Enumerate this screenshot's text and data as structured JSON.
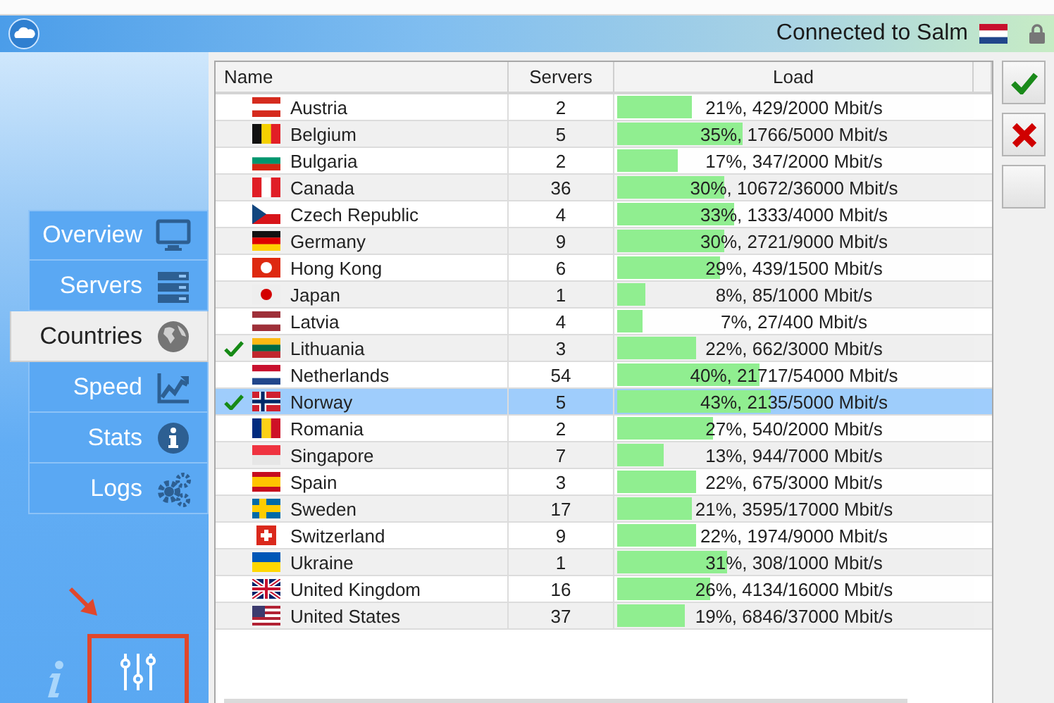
{
  "title_bar": {
    "status": "Connected to Salm"
  },
  "sidebar": {
    "items": [
      {
        "label": "Overview",
        "selected": false
      },
      {
        "label": "Servers",
        "selected": false
      },
      {
        "label": "Countries",
        "selected": true
      },
      {
        "label": "Speed",
        "selected": false
      },
      {
        "label": "Stats",
        "selected": false
      },
      {
        "label": "Logs",
        "selected": false
      }
    ]
  },
  "table": {
    "columns": [
      "Name",
      "Servers",
      "Load"
    ],
    "rows": [
      {
        "name": "Austria",
        "servers": "2",
        "load": "21%, 429/2000 Mbit/s",
        "level": 0.21,
        "checked": false,
        "selected": false
      },
      {
        "name": "Belgium",
        "servers": "5",
        "load": "35%, 1766/5000 Mbit/s",
        "level": 0.35,
        "checked": false,
        "selected": false
      },
      {
        "name": "Bulgaria",
        "servers": "2",
        "load": "17%, 347/2000 Mbit/s",
        "level": 0.17,
        "checked": false,
        "selected": false
      },
      {
        "name": "Canada",
        "servers": "36",
        "load": "30%, 10672/36000 Mbit/s",
        "level": 0.3,
        "checked": false,
        "selected": false
      },
      {
        "name": "Czech Republic",
        "servers": "4",
        "load": "33%, 1333/4000 Mbit/s",
        "level": 0.33,
        "checked": false,
        "selected": false
      },
      {
        "name": "Germany",
        "servers": "9",
        "load": "30%, 2721/9000 Mbit/s",
        "level": 0.3,
        "checked": false,
        "selected": false
      },
      {
        "name": "Hong Kong",
        "servers": "6",
        "load": "29%, 439/1500 Mbit/s",
        "level": 0.29,
        "checked": false,
        "selected": false
      },
      {
        "name": "Japan",
        "servers": "1",
        "load": "8%, 85/1000 Mbit/s",
        "level": 0.08,
        "checked": false,
        "selected": false
      },
      {
        "name": "Latvia",
        "servers": "4",
        "load": "7%, 27/400 Mbit/s",
        "level": 0.07,
        "checked": false,
        "selected": false
      },
      {
        "name": "Lithuania",
        "servers": "3",
        "load": "22%, 662/3000 Mbit/s",
        "level": 0.22,
        "checked": true,
        "selected": false
      },
      {
        "name": "Netherlands",
        "servers": "54",
        "load": "40%, 21717/54000 Mbit/s",
        "level": 0.4,
        "checked": false,
        "selected": false
      },
      {
        "name": "Norway",
        "servers": "5",
        "load": "43%, 2135/5000 Mbit/s",
        "level": 0.43,
        "checked": true,
        "selected": true
      },
      {
        "name": "Romania",
        "servers": "2",
        "load": "27%, 540/2000 Mbit/s",
        "level": 0.27,
        "checked": false,
        "selected": false
      },
      {
        "name": "Singapore",
        "servers": "7",
        "load": "13%, 944/7000 Mbit/s",
        "level": 0.13,
        "checked": false,
        "selected": false
      },
      {
        "name": "Spain",
        "servers": "3",
        "load": "22%, 675/3000 Mbit/s",
        "level": 0.22,
        "checked": false,
        "selected": false
      },
      {
        "name": "Sweden",
        "servers": "17",
        "load": "21%, 3595/17000 Mbit/s",
        "level": 0.21,
        "checked": false,
        "selected": false
      },
      {
        "name": "Switzerland",
        "servers": "9",
        "load": "22%, 1974/9000 Mbit/s",
        "level": 0.22,
        "checked": false,
        "selected": false
      },
      {
        "name": "Ukraine",
        "servers": "1",
        "load": "31%, 308/1000 Mbit/s",
        "level": 0.31,
        "checked": false,
        "selected": false
      },
      {
        "name": "United Kingdom",
        "servers": "16",
        "load": "26%, 4134/16000 Mbit/s",
        "level": 0.26,
        "checked": false,
        "selected": false
      },
      {
        "name": "United States",
        "servers": "37",
        "load": "19%, 6846/37000 Mbit/s",
        "level": 0.19,
        "checked": false,
        "selected": false
      }
    ]
  }
}
